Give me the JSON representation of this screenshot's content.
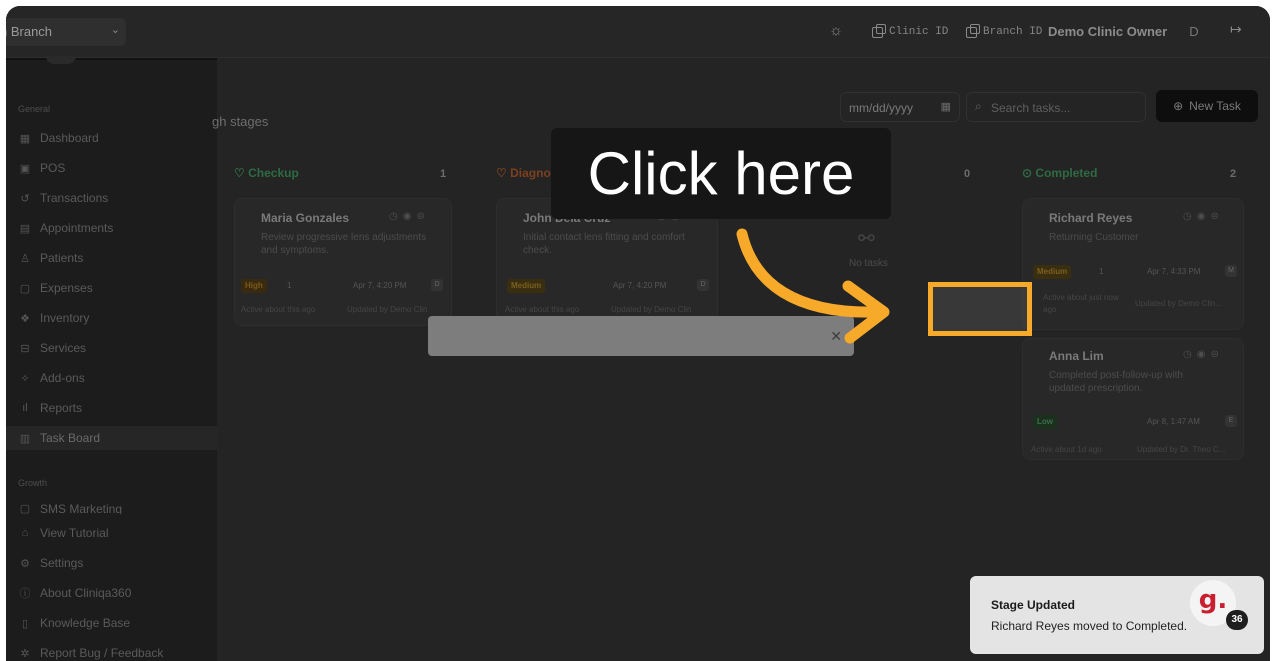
{
  "topbar": {
    "branch_select": "n Branch",
    "clinic_id_label": "Clinic ID",
    "branch_id_label": "Branch ID",
    "owner_name": "Demo Clinic Owner",
    "avatar_initial": "D"
  },
  "sidebar": {
    "general_label": "General",
    "growth_label": "Growth",
    "items": [
      {
        "label": "Dashboard",
        "icon": "grid-icon"
      },
      {
        "label": "POS",
        "icon": "pos-icon"
      },
      {
        "label": "Transactions",
        "icon": "history-icon"
      },
      {
        "label": "Appointments",
        "icon": "calendar-icon"
      },
      {
        "label": "Patients",
        "icon": "users-icon"
      },
      {
        "label": "Expenses",
        "icon": "receipt-icon"
      },
      {
        "label": "Inventory",
        "icon": "boxes-icon"
      },
      {
        "label": "Services",
        "icon": "services-icon"
      },
      {
        "label": "Add-ons",
        "icon": "puzzle-icon"
      },
      {
        "label": "Reports",
        "icon": "bar-chart-icon"
      },
      {
        "label": "Task Board",
        "icon": "kanban-icon"
      }
    ],
    "growth_items": [
      {
        "label": "SMS Marketing",
        "icon": "message-icon"
      }
    ],
    "bottom_items": [
      {
        "label": "View Tutorial",
        "icon": "graduation-icon"
      },
      {
        "label": "Settings",
        "icon": "gear-icon"
      },
      {
        "label": "About Cliniqa360",
        "icon": "info-icon"
      },
      {
        "label": "Knowledge Base",
        "icon": "book-icon"
      },
      {
        "label": "Report Bug / Feedback",
        "icon": "bug-icon"
      }
    ]
  },
  "main": {
    "subtitle": "gh stages",
    "date_placeholder": "mm/dd/yyyy",
    "search_placeholder": "Search tasks...",
    "new_task_label": "New Task"
  },
  "columns": [
    {
      "title": "Checkup",
      "count": "1",
      "color": "#2e7d4a"
    },
    {
      "title": "Diagno",
      "count": "",
      "color": "#a0522d"
    },
    {
      "title": "",
      "count": "0",
      "color": "#6c6c6c"
    },
    {
      "title": "Completed",
      "count": "2",
      "color": "#2e7d4a"
    }
  ],
  "cards": {
    "maria": {
      "name": "Maria Gonzales",
      "desc1": "Review progressive lens adjustments",
      "desc2": "and symptoms.",
      "priority": "High",
      "comments": "1",
      "time": "Apr 7, 4:20 PM",
      "mini": "D",
      "foot": "Active about this ago",
      "updated": "Updated by Demo Clin"
    },
    "john": {
      "name": "John Dela Cruz",
      "desc1": "Initial contact lens fitting and comfort",
      "desc2": "check.",
      "priority": "Medium",
      "time": "Apr 7, 4:20 PM",
      "mini": "D",
      "foot": "Active about this ago",
      "updated": "Updated by Demo Clin"
    },
    "richard": {
      "name": "Richard Reyes",
      "desc1": "Returning Customer",
      "priority": "Medium",
      "comments": "1",
      "time": "Apr 7, 4:33 PM",
      "mini": "M",
      "foot1": "Active about just now",
      "foot2": "ago",
      "updated": "Updated by Demo Clin..."
    },
    "anna": {
      "name": "Anna Lim",
      "desc1": "Completed post-follow-up with",
      "desc2": "updated prescription.",
      "priority": "Low",
      "time": "Apr 8, 1:47 AM",
      "mini": "E",
      "foot": "Active about 1d ago",
      "updated": "Updated by Dr. Theo C..."
    }
  },
  "empty_state": "No tasks",
  "callout": {
    "text": "Click here",
    "accent": "#f7aa2a"
  },
  "toast": {
    "title": "Stage Updated",
    "message": "Richard Reyes moved to Completed."
  },
  "widget": {
    "logo": "g.",
    "count": "36",
    "brand_color": "#c82031"
  }
}
